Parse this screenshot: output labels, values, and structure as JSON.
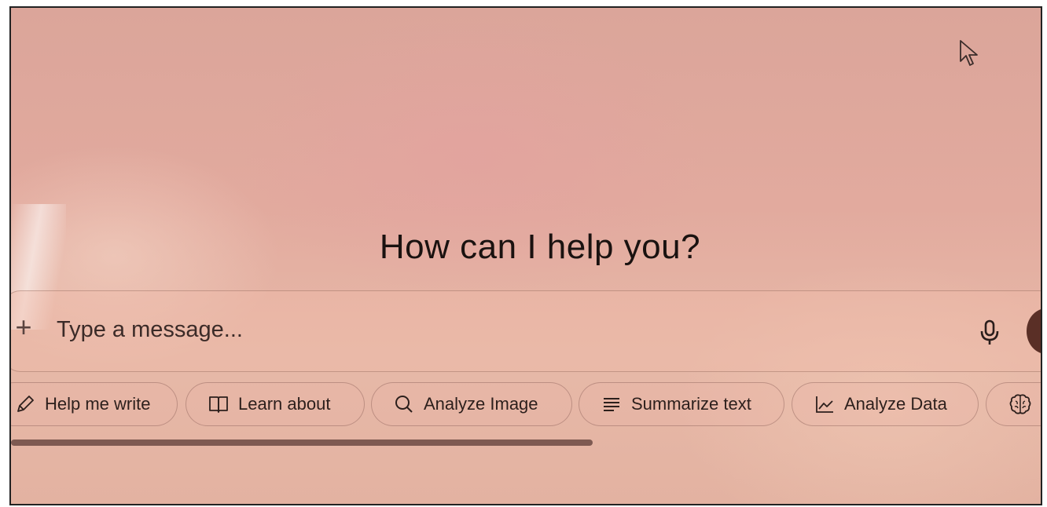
{
  "greeting": "How can I help you?",
  "composer": {
    "placeholder": "Type a message..."
  },
  "suggestions": [
    {
      "label": "Help me write",
      "icon": "pencil-icon"
    },
    {
      "label": "Learn about",
      "icon": "book-icon"
    },
    {
      "label": "Analyze Image",
      "icon": "search-icon"
    },
    {
      "label": "Summarize text",
      "icon": "text-lines-icon"
    },
    {
      "label": "Analyze Data",
      "icon": "line-chart-icon"
    },
    {
      "label": "",
      "icon": "brain-icon"
    }
  ],
  "colors": {
    "background": "#e2aa9e",
    "text": "#1a1210",
    "send_button": "#5a2f26"
  }
}
